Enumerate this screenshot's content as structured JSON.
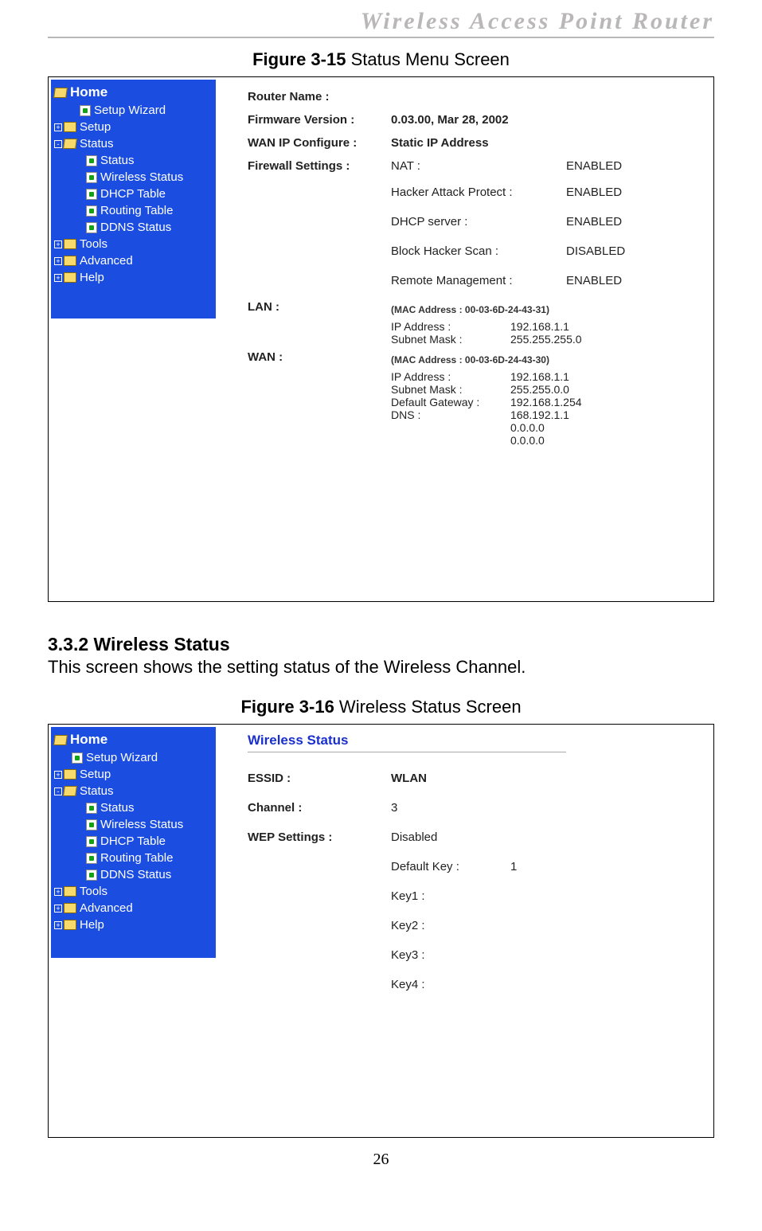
{
  "doc_header": "Wireless  Access  Point  Router",
  "figure1_caption_bold": "Figure 3-15",
  "figure1_caption_text": " Status Menu Screen",
  "nav": {
    "home": "Home",
    "setup_wizard": "Setup Wizard",
    "setup": "Setup",
    "status": "Status",
    "status_sub": {
      "status": "Status",
      "wireless_status": "Wireless Status",
      "dhcp_table": "DHCP Table",
      "routing_table": "Routing Table",
      "ddns_status": "DDNS Status"
    },
    "tools": "Tools",
    "advanced": "Advanced",
    "help": "Help"
  },
  "status_panel": {
    "router_name_label": "Router Name :",
    "router_name_value": "",
    "firmware_label": "Firmware Version :",
    "firmware_value": "0.03.00, Mar 28, 2002",
    "wan_ip_cfg_label": "WAN IP Configure :",
    "wan_ip_cfg_value": "Static IP Address",
    "firewall_label": "Firewall Settings :",
    "fw": {
      "nat_label": "NAT :",
      "nat_value": "ENABLED",
      "hap_label": "Hacker Attack Protect :",
      "hap_value": "ENABLED",
      "dhcp_label": "DHCP server :",
      "dhcp_value": "ENABLED",
      "bhs_label": "Block Hacker Scan :",
      "bhs_value": "DISABLED",
      "rm_label": "Remote Management :",
      "rm_value": "ENABLED"
    },
    "lan_label": "LAN :",
    "lan_mac": "(MAC Address : 00-03-6D-24-43-31)",
    "lan_ip_label": "IP Address :",
    "lan_ip_value": "192.168.1.1",
    "lan_mask_label": "Subnet Mask :",
    "lan_mask_value": "255.255.255.0",
    "wan_label": "WAN :",
    "wan_mac": "(MAC Address : 00-03-6D-24-43-30)",
    "wan_ip_label": "IP Address :",
    "wan_ip_value": "192.168.1.1",
    "wan_mask_label": "Subnet Mask :",
    "wan_mask_value": "255.255.0.0",
    "wan_gw_label": "Default Gateway :",
    "wan_gw_value": "192.168.1.254",
    "wan_dns_label": "DNS :",
    "wan_dns_value": "168.192.1.1",
    "wan_dns_value2": "0.0.0.0",
    "wan_dns_value3": "0.0.0.0"
  },
  "section_heading": "3.3.2 Wireless Status",
  "section_body": "This screen shows the setting status of the Wireless Channel.",
  "figure2_caption_bold": "Figure 3-16",
  "figure2_caption_text": " Wireless Status Screen",
  "wireless_panel": {
    "title": "Wireless Status",
    "essid_label": "ESSID :",
    "essid_value": "WLAN",
    "channel_label": "Channel :",
    "channel_value": "3",
    "wep_label": "WEP Settings :",
    "wep_value": "Disabled",
    "default_key_label": "Default Key :",
    "default_key_value": "1",
    "key1": "Key1 :",
    "key2": "Key2 :",
    "key3": "Key3 :",
    "key4": "Key4 :"
  },
  "page_number": "26"
}
